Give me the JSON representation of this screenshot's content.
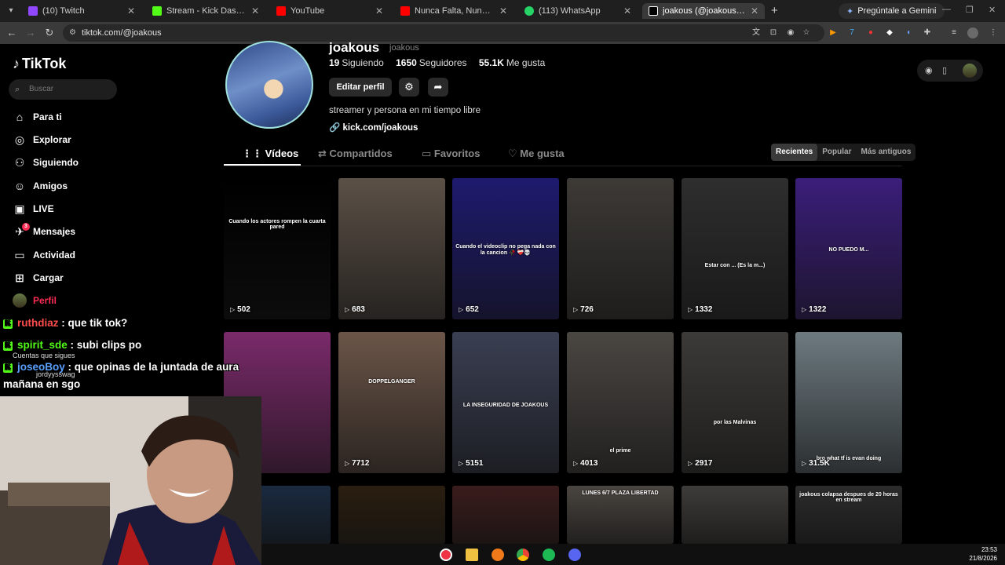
{
  "browser": {
    "tabs": [
      {
        "label": "(10) Twitch",
        "color": "#9146ff"
      },
      {
        "label": "Stream - Kick Dashboard",
        "color": "#53fc18"
      },
      {
        "label": "YouTube",
        "color": "#ff0000"
      },
      {
        "label": "Nunca Falta, Nunca Sobra - You",
        "color": "#ff0000"
      },
      {
        "label": "(113) WhatsApp",
        "color": "#25d366"
      },
      {
        "label": "joakous (@joakous) | TikTok",
        "color": "#ffffff"
      }
    ],
    "gemini_label": "Pregúntale a Gemini",
    "url": "tiktok.com/@joakous"
  },
  "sidebar": {
    "logo": "TikTok",
    "search_placeholder": "Buscar",
    "items": [
      {
        "label": "Para ti",
        "icon": "home-icon"
      },
      {
        "label": "Explorar",
        "icon": "compass-icon"
      },
      {
        "label": "Siguiendo",
        "icon": "following-icon"
      },
      {
        "label": "Amigos",
        "icon": "friends-icon"
      },
      {
        "label": "LIVE",
        "icon": "live-icon"
      },
      {
        "label": "Mensajes",
        "icon": "messages-icon",
        "badge": "3"
      },
      {
        "label": "Actividad",
        "icon": "activity-icon"
      },
      {
        "label": "Cargar",
        "icon": "upload-icon"
      },
      {
        "label": "Perfil",
        "icon": "avatar"
      }
    ]
  },
  "profile": {
    "name": "joakous",
    "username": "joakous",
    "following_count": "19",
    "following_label": "Siguiendo",
    "followers_count": "1650",
    "followers_label": "Seguidores",
    "likes_count": "55.1K",
    "likes_label": "Me gusta",
    "edit_button": "Editar perfil",
    "bio": "streamer y persona en mi tiempo libre",
    "link": "kick.com/joakous"
  },
  "tabs": [
    "Vídeos",
    "Compartidos",
    "Favoritos",
    "Me gusta"
  ],
  "sort_options": [
    "Recientes",
    "Popular",
    "Más antiguos"
  ],
  "videos": [
    {
      "views": "502",
      "caption": "Cuando los actores rompen la cuarta pared",
      "bg": "#000000"
    },
    {
      "views": "683",
      "caption": "",
      "bg": "#5b5046"
    },
    {
      "views": "652",
      "caption": "Cuando el videoclip no pega nada con la cancion 🥀 ❤️‍🩹💀",
      "bg": "#1e1a6e"
    },
    {
      "views": "726",
      "caption": "",
      "bg": "#3d3a36"
    },
    {
      "views": "1332",
      "caption": "Estar con ... (Es la m...)",
      "bg": "#2e2e2e"
    },
    {
      "views": "1322",
      "caption": "NO PUEDO M...",
      "bg": "#3b1e7a"
    },
    {
      "views": "",
      "caption": "",
      "bg": "#7a2a6a"
    },
    {
      "views": "7712",
      "caption": "DOPPELGANGER",
      "bg": "#6b5548"
    },
    {
      "views": "5151",
      "caption": "LA INSEGURIDAD DE JOAKOUS",
      "bg": "#3a3f52"
    },
    {
      "views": "4013",
      "caption": "el prime",
      "bg": "#4a4642"
    },
    {
      "views": "2917",
      "caption": "por las Malvinas",
      "bg": "#3c3a38"
    },
    {
      "views": "31.5K",
      "caption": "bro what tf is evan doing",
      "bg": "#6d7a80"
    },
    {
      "views": "",
      "caption": "",
      "bg": "#1a2a40"
    },
    {
      "views": "",
      "caption": "",
      "bg": "#2a1e10"
    },
    {
      "views": "",
      "caption": "",
      "bg": "#3a1c1c"
    },
    {
      "views": "",
      "caption": "LUNES 6/7 PLAZA LIBERTAD",
      "bg": "#4a4540"
    },
    {
      "views": "",
      "caption": "",
      "bg": "#3e3c3a"
    },
    {
      "views": "",
      "caption": "joakous colapsa despues de 20 horas en stream",
      "bg": "#2c2c2c"
    }
  ],
  "chat": [
    {
      "user": "ruthdiaz",
      "user_color": "#ff4d4d",
      "message": ": que tik tok?"
    },
    {
      "user": "spirit_sde",
      "user_color": "#53fc18",
      "message": ": subi clips po"
    },
    {
      "user": "joseoBoy",
      "user_color": "#5aa0ff",
      "message": ": que opinas de la juntada de aura"
    },
    {
      "user": "",
      "user_color": "#ffffff",
      "message": "mañana en sgo"
    }
  ],
  "follow_note": "Cuentas que sigues",
  "follow_user": "jordyysswag",
  "clock": {
    "time": "23:53",
    "date": "21/8/2026"
  }
}
